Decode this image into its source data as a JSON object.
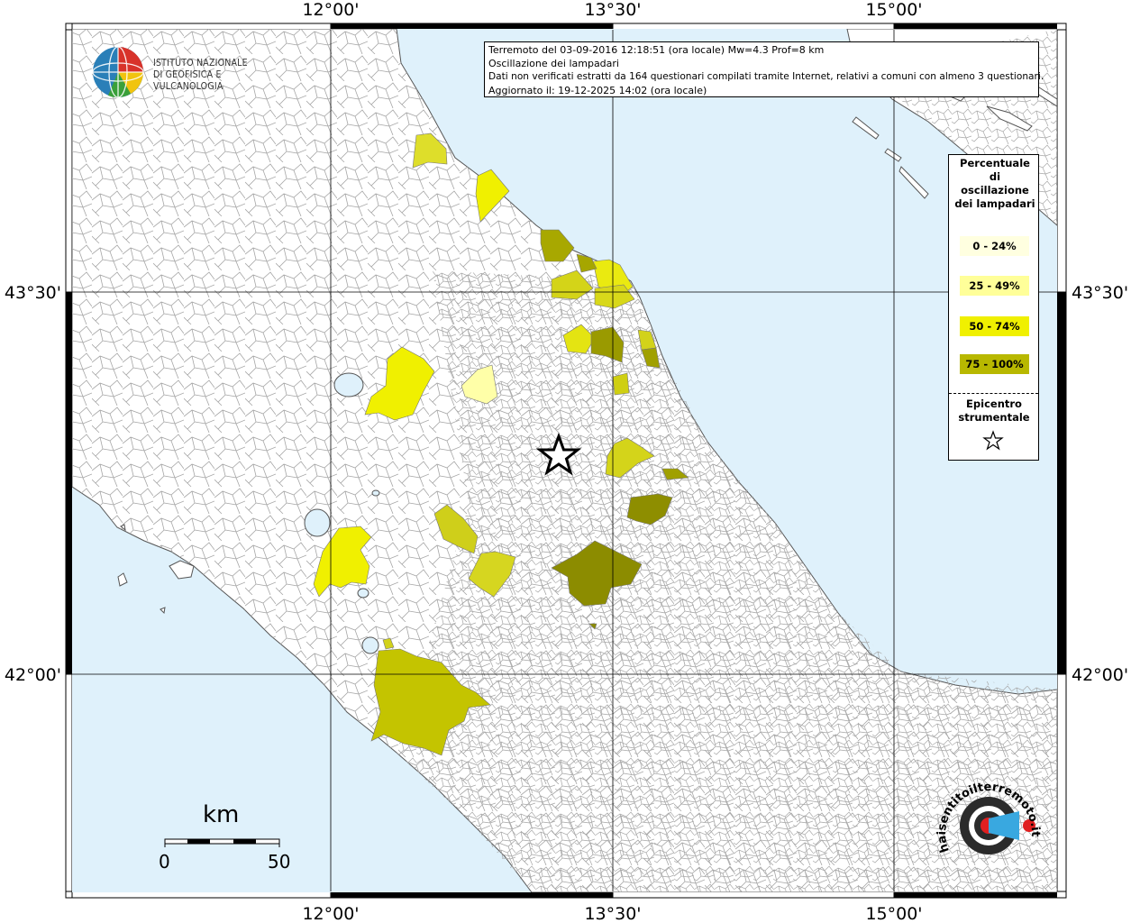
{
  "header": {
    "line1": "Terremoto del 03-09-2016 12:18:51 (ora locale) Mw=4.3 Prof=8 km",
    "line2": "Oscillazione dei lampadari",
    "line3": "Dati non verificati estratti da 164 questionari compilati tramite Internet, relativi a comuni con almeno 3 questionari.",
    "line4": "Aggiornato il: 19-12-2025 14:02 (ora locale)"
  },
  "coordinates": {
    "lon_top": [
      "12°00'",
      "13°30'",
      "15°00'"
    ],
    "lon_bottom": [
      "12°00'",
      "13°30'",
      "15°00'"
    ],
    "lat_left": [
      "43°30'",
      "42°00'"
    ],
    "lat_right": [
      "43°30'",
      "42°00'"
    ]
  },
  "legend": {
    "title": "Percentuale di oscillazione dei lampadari",
    "items": [
      {
        "label": "0 - 24%",
        "color": "#ffffe0"
      },
      {
        "label": "25 - 49%",
        "color": "#ffff99"
      },
      {
        "label": "50 - 74%",
        "color": "#f0f000"
      },
      {
        "label": "75 - 100%",
        "color": "#b8b800"
      }
    ],
    "epicenter_label": "Epicentro strumentale",
    "epicenter_icon": "star-icon"
  },
  "colors": {
    "sea": "#dff1fb",
    "land": "#ffffff",
    "borders": "#9a9a9a",
    "class_0_24": "#ffffe0",
    "class_25_49": "#ffff99",
    "class_50_74": "#f0f000",
    "class_75_100": "#b8b800",
    "class_dark": "#8e8e00"
  },
  "scale_bar": {
    "unit": "km",
    "start": "0",
    "end": "50"
  },
  "logo": {
    "line1": "ISTITUTO NAZIONALE",
    "line2": "DI GEOFISICA E VULCANOLOGIA",
    "hsi": "haisentitoilterremoto.it"
  }
}
